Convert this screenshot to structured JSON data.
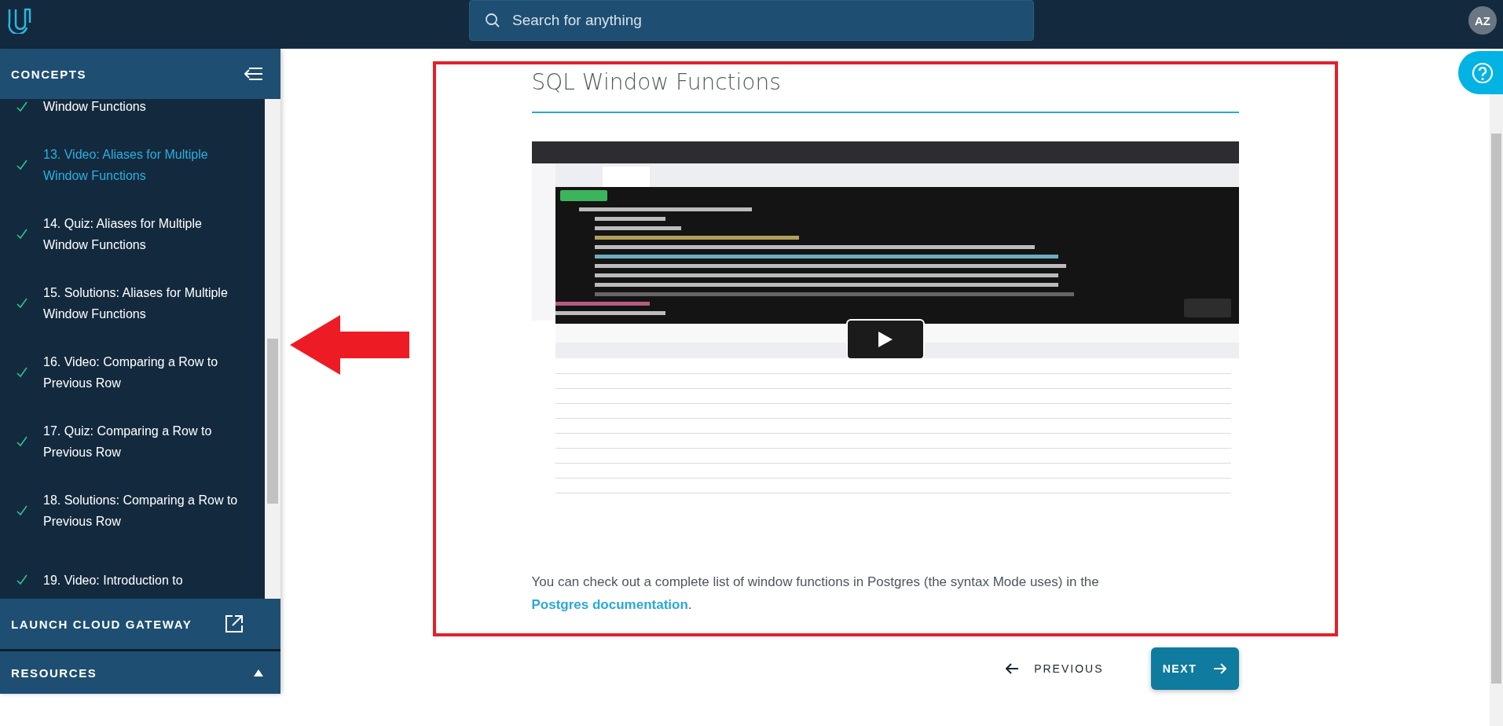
{
  "header": {
    "search": {
      "placeholder": "Search for anything"
    },
    "avatar": "AZ"
  },
  "sidebar": {
    "title": "CONCEPTS",
    "items": [
      {
        "title": "Window Functions",
        "selected": false,
        "completed": true
      },
      {
        "title": "13. Video: Aliases for Multiple Window Functions",
        "selected": true,
        "completed": true
      },
      {
        "title": "14. Quiz: Aliases for Multiple Window Functions",
        "selected": false,
        "completed": true
      },
      {
        "title": "15. Solutions: Aliases for Multiple Window Functions",
        "selected": false,
        "completed": true
      },
      {
        "title": "16. Video: Comparing a Row to Previous Row",
        "selected": false,
        "completed": true
      },
      {
        "title": "17. Quiz: Comparing a Row to Previous Row",
        "selected": false,
        "completed": true
      },
      {
        "title": "18. Solutions: Comparing a Row to Previous Row",
        "selected": false,
        "completed": true
      },
      {
        "title": "19. Video: Introduction to",
        "selected": false,
        "completed": true
      }
    ],
    "launch": "LAUNCH CLOUD GATEWAY",
    "resources": "RESOURCES"
  },
  "lesson": {
    "title": "SQL Window Functions",
    "paragraph": {
      "before": "You can check out a complete list of window functions in Postgres (the syntax Mode uses) in the ",
      "link": "Postgres documentation",
      "after": "."
    }
  },
  "nav": {
    "previous": "PREVIOUS",
    "next": "NEXT"
  }
}
